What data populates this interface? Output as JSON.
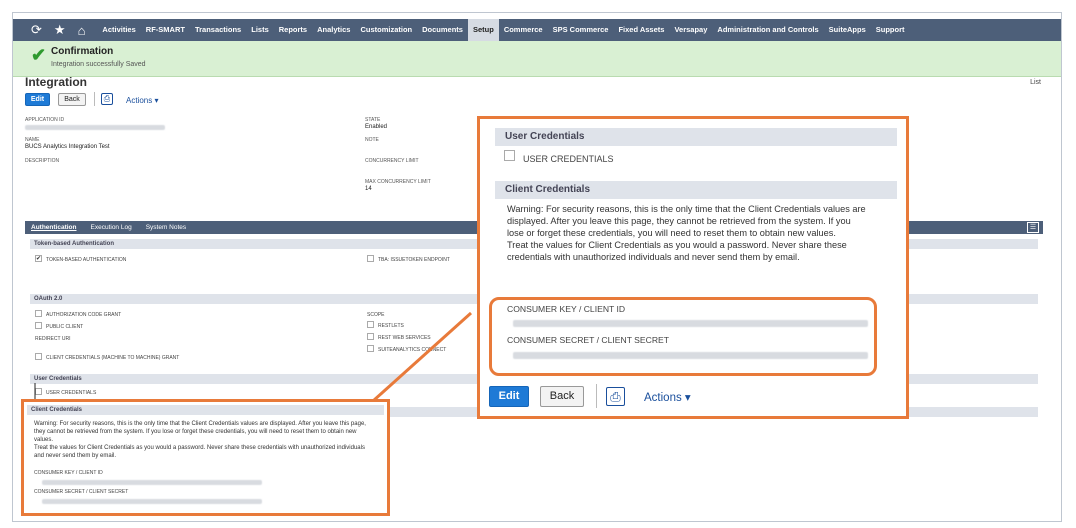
{
  "nav": {
    "items": [
      "Activities",
      "RF-SMART",
      "Transactions",
      "Lists",
      "Reports",
      "Analytics",
      "Customization",
      "Documents",
      "Setup",
      "Commerce",
      "SPS Commerce",
      "Fixed Assets",
      "Versapay",
      "Administration and Controls",
      "SuiteApps",
      "Support"
    ],
    "active": "Setup"
  },
  "confirmation": {
    "title": "Confirmation",
    "message": "Integration successfully Saved"
  },
  "page": {
    "title": "Integration",
    "list_link": "List",
    "edit_label": "Edit",
    "back_label": "Back",
    "actions_label": "Actions ▾"
  },
  "fields": {
    "application_id_label": "APPLICATION ID",
    "name_label": "NAME",
    "name_value": "BUCS Analytics Integration Test",
    "description_label": "DESCRIPTION",
    "state_label": "STATE",
    "state_value": "Enabled",
    "note_label": "NOTE",
    "concurrency_label": "CONCURRENCY LIMIT",
    "max_concurrency_label": "MAX CONCURRENCY LIMIT",
    "max_concurrency_value": "14"
  },
  "subtabs": [
    "Authentication",
    "Execution Log",
    "System Notes"
  ],
  "auth": {
    "tba_header": "Token-based Authentication",
    "token_based": "TOKEN-BASED AUTHENTICATION",
    "tba_issuetoken": "TBA: ISSUETOKEN ENDPOINT",
    "oauth_header": "OAuth 2.0",
    "auth_code_grant": "AUTHORIZATION CODE GRANT",
    "public_client": "PUBLIC CLIENT",
    "redirect_uri": "REDIRECT URI",
    "client_credentials_m2m": "CLIENT CREDENTIALS (MACHINE TO MACHINE) GRANT",
    "scope_label": "SCOPE",
    "restlets": "RESTLETS",
    "rest_web_services": "REST WEB SERVICES",
    "suiteanalytics_connect": "SUITEANALYTICS CONNECT",
    "user_credentials_header": "User Credentials",
    "user_credentials": "USER CREDENTIALS",
    "client_credentials_header": "Client Credentials"
  },
  "client_credentials": {
    "warning_small": "Warning: For security reasons, this is the only time that the Client Credentials values are displayed. After you leave this page, they cannot be retrieved from the system. If you lose or forget these credentials, you will need to reset them to obtain new values.",
    "treat_small": "Treat the values for Client Credentials as you would a password. Never share these credentials with unauthorized individuals and never send them by email.",
    "warning_big": "Warning: For security reasons, this is the only time that the Client Credentials values are displayed. After you leave this page, they cannot be retrieved from the system. If you lose or forget these credentials, you will need to reset them to obtain new values.",
    "treat_big": "Treat the values for Client Credentials as you would a password. Never share these credentials with unauthorized individuals and never send them by email.",
    "consumer_key_label": "CONSUMER KEY / CLIENT ID",
    "consumer_secret_label": "CONSUMER SECRET / CLIENT SECRET"
  },
  "colors": {
    "nav": "#4d5f79",
    "accent": "#e87a3a",
    "edit": "#1e7ad6",
    "confirm_bg": "#d9f0d3"
  }
}
